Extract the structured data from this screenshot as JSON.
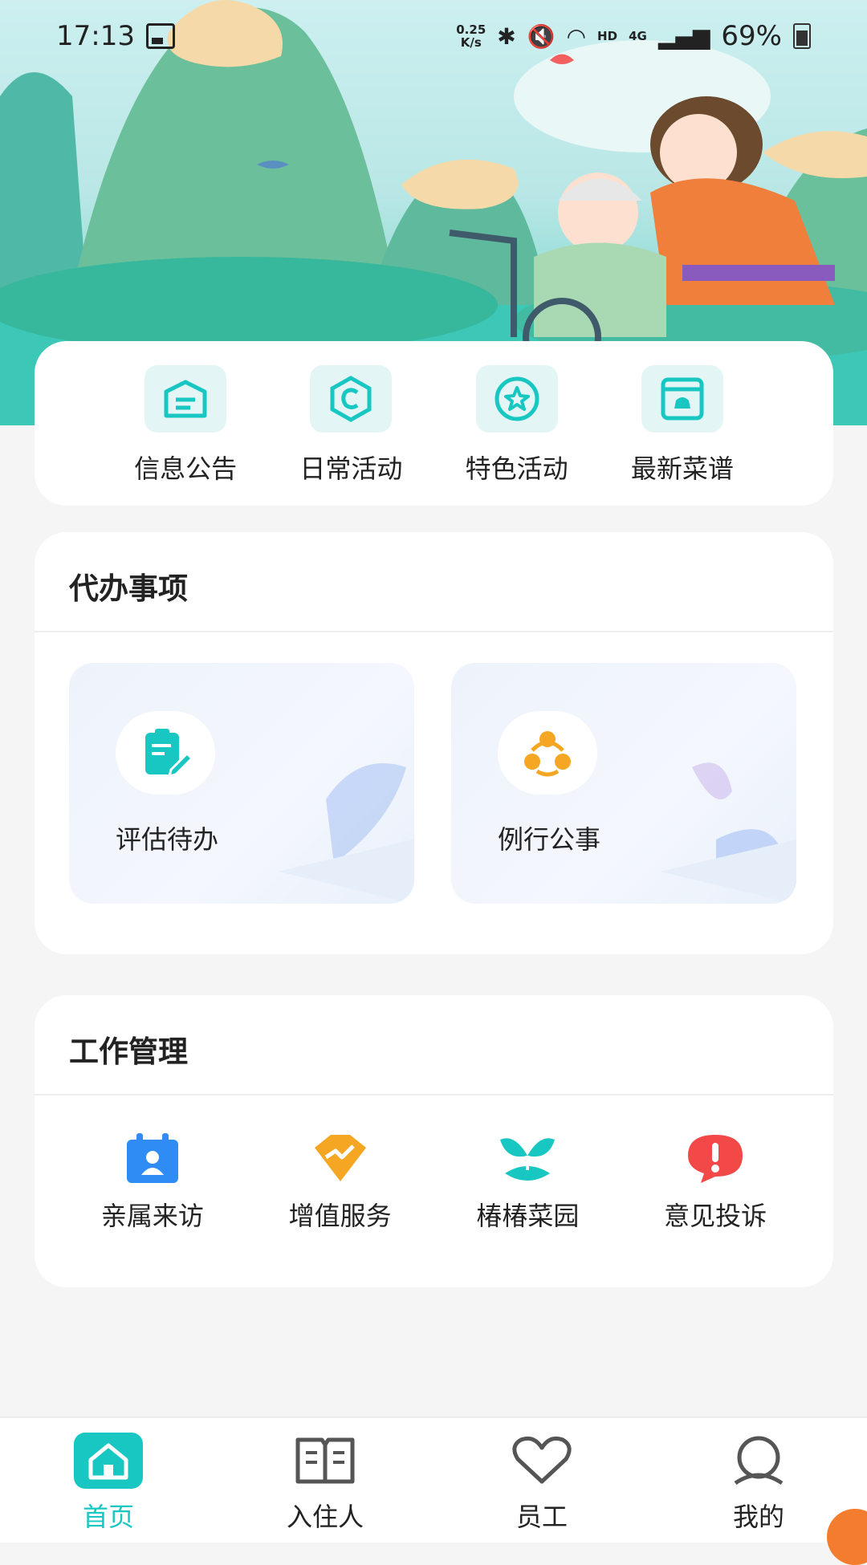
{
  "status_bar": {
    "time": "17:13",
    "net_speed_top": "0.25",
    "net_speed_unit": "K/s",
    "network": "HD",
    "signal": "4G",
    "battery": "69%"
  },
  "quick_menu": [
    {
      "label": "信息公告",
      "icon": "notice-icon"
    },
    {
      "label": "日常活动",
      "icon": "activity-icon"
    },
    {
      "label": "特色活动",
      "icon": "star-icon"
    },
    {
      "label": "最新菜谱",
      "icon": "menu-icon"
    }
  ],
  "todo": {
    "title": "代办事项",
    "items": [
      {
        "label": "评估待办",
        "icon": "clipboard-edit-icon",
        "color": "#19c7c2"
      },
      {
        "label": "例行公事",
        "icon": "group-icon",
        "color": "#f5a623"
      }
    ]
  },
  "work": {
    "title": "工作管理",
    "items": [
      {
        "label": "亲属来访",
        "icon": "calendar-person-icon",
        "color": "#2f8cf5"
      },
      {
        "label": "增值服务",
        "icon": "trend-icon",
        "color": "#f5a623"
      },
      {
        "label": "椿椿菜园",
        "icon": "sprout-icon",
        "color": "#19c7c2"
      },
      {
        "label": "意见投诉",
        "icon": "alert-icon",
        "color": "#f24848"
      }
    ]
  },
  "nav": [
    {
      "label": "首页",
      "icon": "home-icon",
      "active": true
    },
    {
      "label": "入住人",
      "icon": "book-icon",
      "active": false
    },
    {
      "label": "员工",
      "icon": "heart-icon",
      "active": false
    },
    {
      "label": "我的",
      "icon": "user-icon",
      "active": false
    }
  ],
  "colors": {
    "accent": "#19c7c2",
    "orange": "#f5a623",
    "blue": "#2f8cf5",
    "red": "#f24848"
  }
}
